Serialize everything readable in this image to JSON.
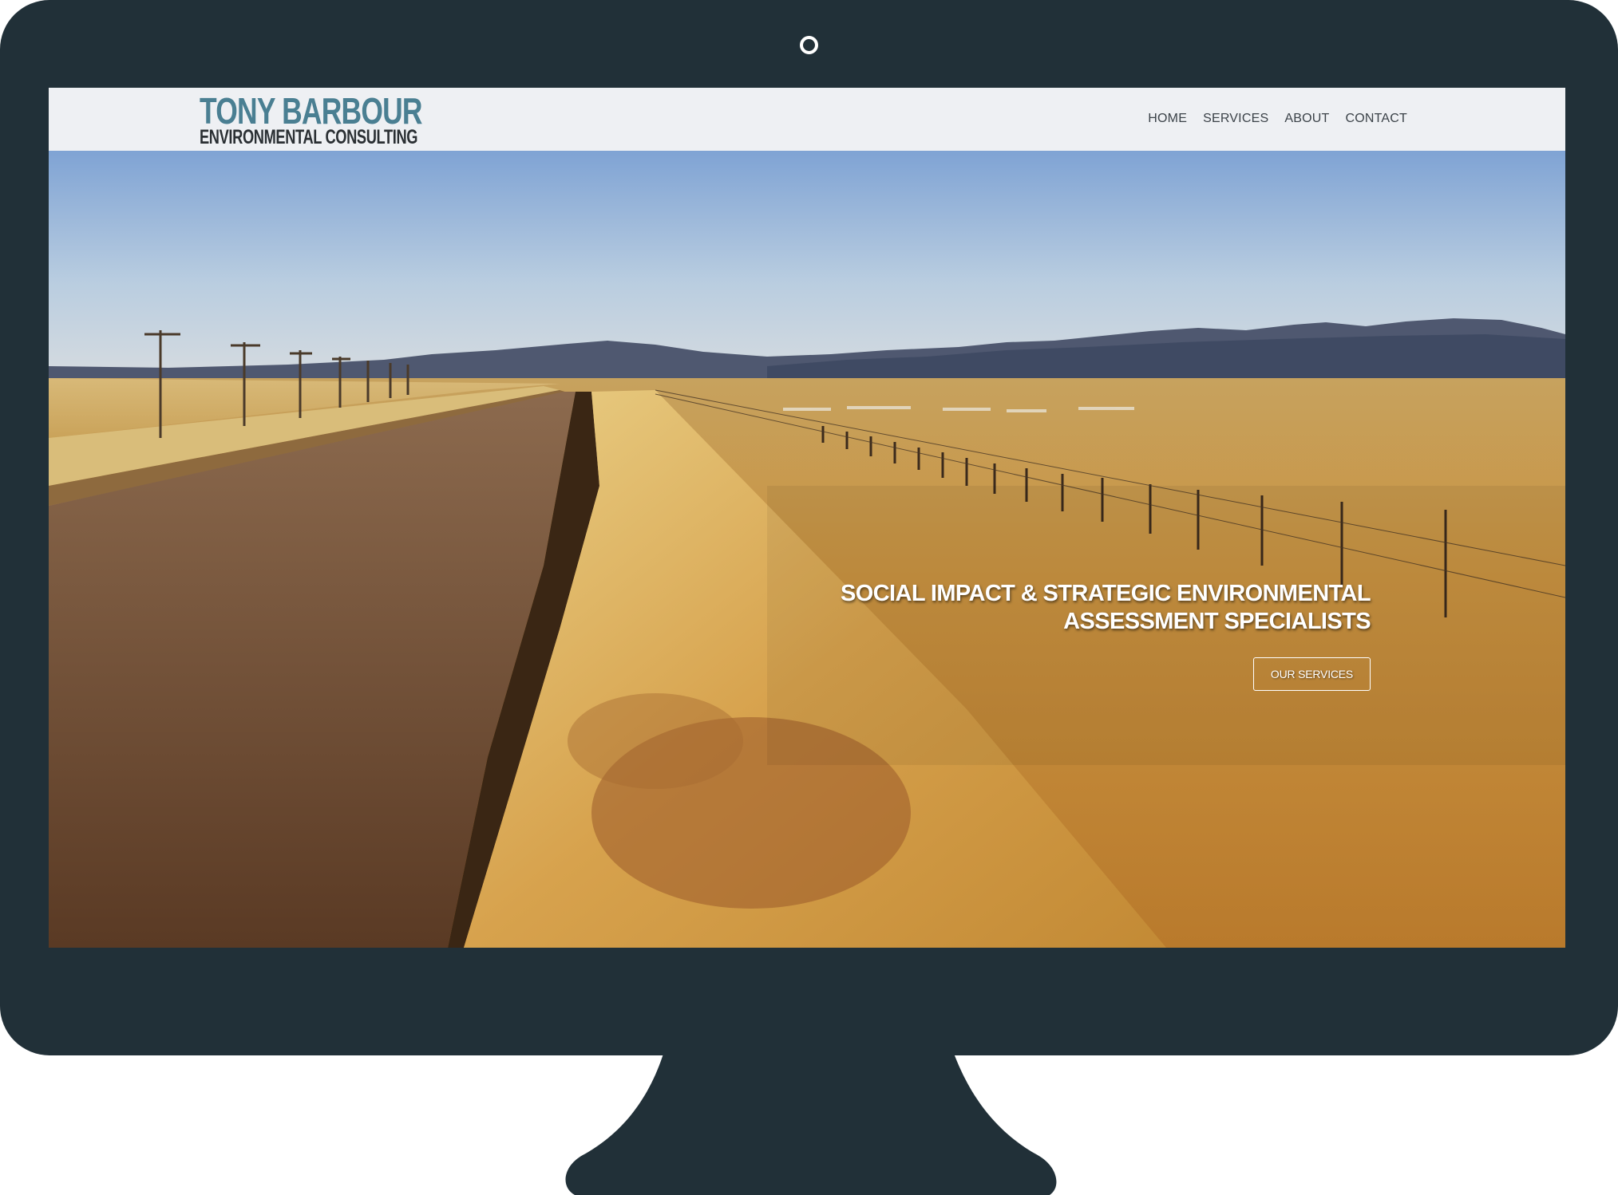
{
  "logo": {
    "line1": "TONY BARBOUR",
    "line2": "ENVIRONMENTAL CONSULTING"
  },
  "nav": {
    "items": [
      {
        "label": "HOME"
      },
      {
        "label": "SERVICES"
      },
      {
        "label": "ABOUT"
      },
      {
        "label": "CONTACT"
      }
    ]
  },
  "hero": {
    "tagline_line1": "SOCIAL IMPACT & STRATEGIC ENVIRONMENTAL",
    "tagline_line2": "ASSESSMENT SPECIALISTS",
    "cta_label": "OUR SERVICES"
  },
  "colors": {
    "monitor": "#213038",
    "logo_accent": "#4a7f92",
    "navbar_bg": "#eef0f3"
  }
}
